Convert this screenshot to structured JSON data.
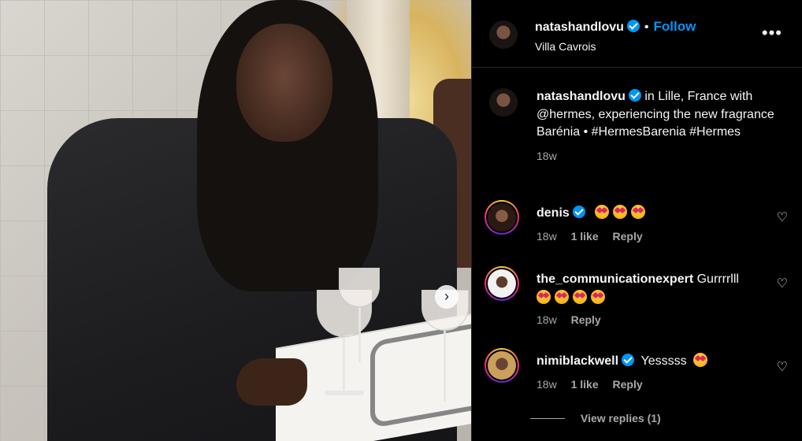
{
  "header": {
    "username": "natashandlovu",
    "follow_label": "Follow",
    "location": "Villa Cavrois",
    "more_label": "•••"
  },
  "caption": {
    "username": "natashandlovu",
    "text": "in Lille, France with @hermes, experiencing the new fragrance Barénia • #HermesBarenia #Hermes",
    "time": "18w"
  },
  "comments": [
    {
      "username": "denis",
      "verified": true,
      "text": "",
      "emoji_count": 3,
      "time": "18w",
      "likes": "1 like",
      "reply_label": "Reply"
    },
    {
      "username": "the_communicationexpert",
      "verified": false,
      "text": "Gurrrrlll",
      "emoji_count": 4,
      "time": "18w",
      "likes": "",
      "reply_label": "Reply"
    },
    {
      "username": "nimiblackwell",
      "verified": true,
      "text": "Yesssss",
      "emoji_count": 1,
      "time": "18w",
      "likes": "1 like",
      "reply_label": "Reply",
      "view_replies": "View replies (1)"
    }
  ],
  "icons": {
    "verified": "verified-badge-icon",
    "heart": "heart-outline-icon",
    "emoji": "heart-eyes-emoji",
    "carousel": "carousel-next-icon"
  },
  "colors": {
    "accent": "#0095f6",
    "background": "#000000",
    "secondary_text": "#a8a8a8"
  }
}
